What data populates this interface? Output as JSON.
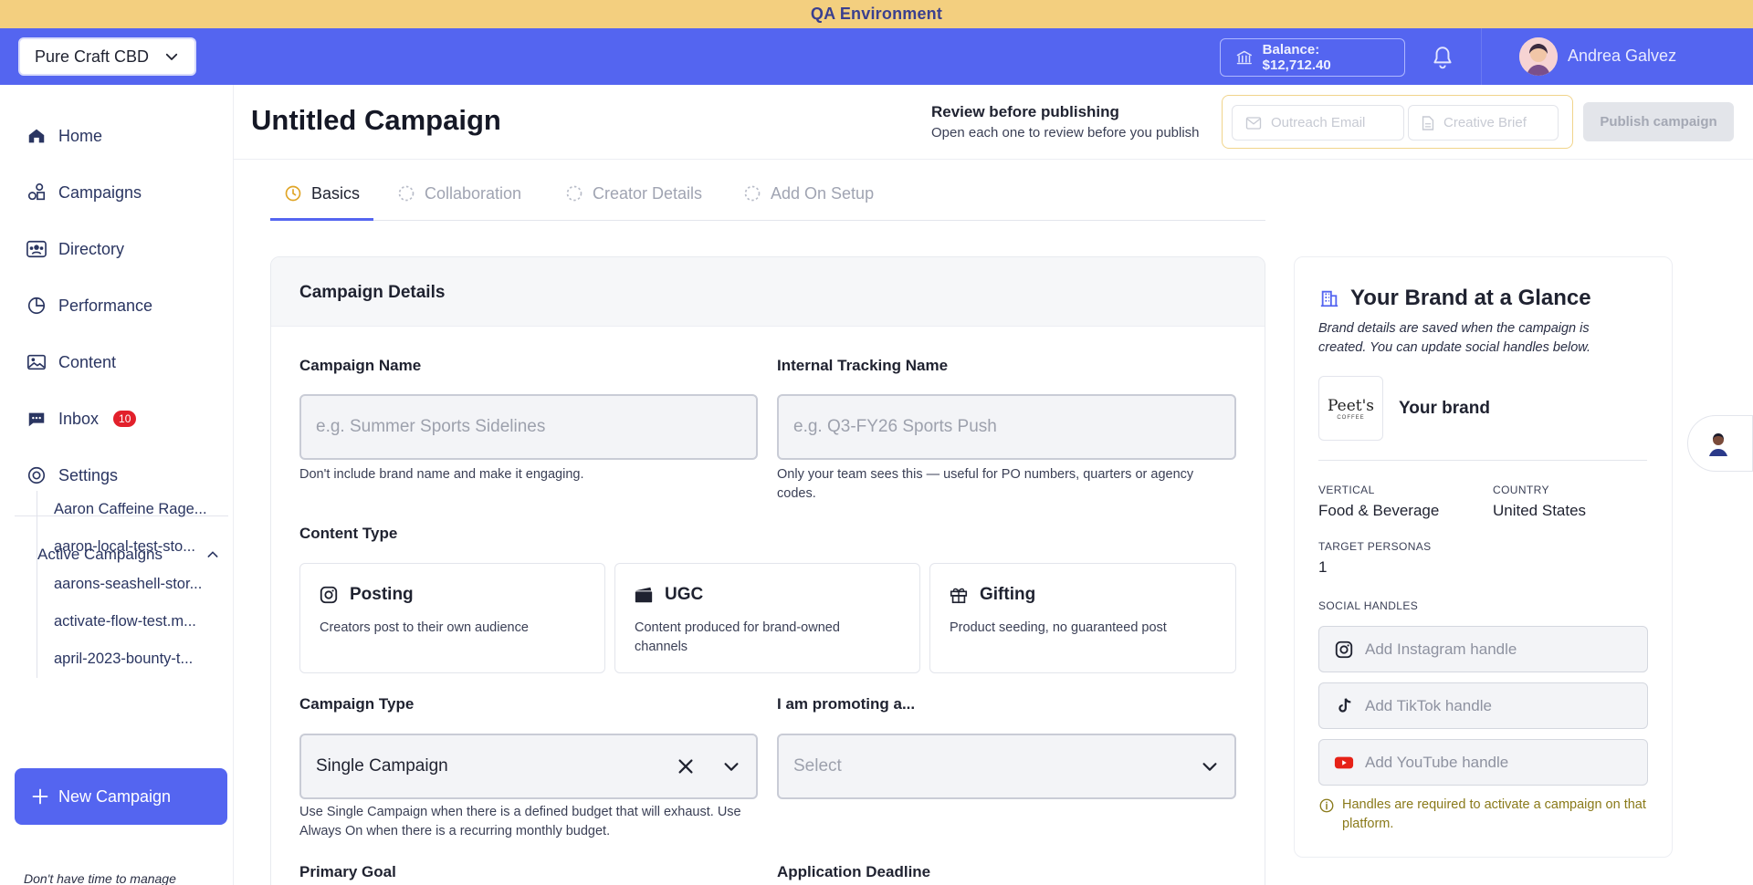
{
  "qa_banner": "QA Environment",
  "topbar": {
    "brand_selector": "Pure Craft CBD",
    "balance": "Balance: $12,712.40",
    "user_name": "Andrea Galvez"
  },
  "sidebar": {
    "items": [
      {
        "label": "Home",
        "icon": "home-icon"
      },
      {
        "label": "Campaigns",
        "icon": "campaigns-icon"
      },
      {
        "label": "Directory",
        "icon": "directory-icon"
      },
      {
        "label": "Performance",
        "icon": "performance-icon"
      },
      {
        "label": "Content",
        "icon": "content-icon"
      },
      {
        "label": "Inbox",
        "icon": "inbox-icon",
        "badge": "10"
      },
      {
        "label": "Settings",
        "icon": "settings-icon"
      }
    ],
    "active_campaigns_label": "Active Campaigns",
    "active_campaigns": [
      "Aaron Caffeine Rage...",
      "aaron-local-test-sto...",
      "aarons-seashell-stor...",
      "activate-flow-test.m...",
      "april-2023-bounty-t..."
    ],
    "new_campaign_label": "New Campaign",
    "footer_text": "Don't have time to manage"
  },
  "header": {
    "title": "Untitled Campaign",
    "review_title": "Review before publishing",
    "review_subtitle": "Open each one to review before you publish",
    "outreach_email": "Outreach Email",
    "creative_brief": "Creative Brief",
    "publish": "Publish campaign"
  },
  "tabs": [
    "Basics",
    "Collaboration",
    "Creator Details",
    "Add On Setup"
  ],
  "form": {
    "section_title": "Campaign Details",
    "campaign_name_label": "Campaign Name",
    "campaign_name_placeholder": "e.g. Summer Sports Sidelines",
    "campaign_name_help": "Don't include brand name and make it engaging.",
    "tracking_label": "Internal Tracking Name",
    "tracking_placeholder": "e.g. Q3-FY26 Sports Push",
    "tracking_help": "Only your team sees this — useful for PO numbers, quarters or agency codes.",
    "content_type_label": "Content Type",
    "content_types": [
      {
        "title": "Posting",
        "desc": "Creators post to their own audience",
        "icon": "instagram-icon"
      },
      {
        "title": "UGC",
        "desc": "Content produced for brand-owned channels",
        "icon": "clapperboard-icon"
      },
      {
        "title": "Gifting",
        "desc": "Product seeding, no guaranteed post",
        "icon": "gift-icon"
      }
    ],
    "campaign_type_label": "Campaign Type",
    "campaign_type_value": "Single Campaign",
    "campaign_type_help": "Use Single Campaign when there is a defined budget that will exhaust. Use Always On when there is a recurring monthly budget.",
    "promoting_label": "I am promoting a...",
    "promoting_placeholder": "Select",
    "primary_goal_label": "Primary Goal",
    "deadline_label": "Application Deadline"
  },
  "brand_panel": {
    "title": "Your Brand at a Glance",
    "subtitle": "Brand details are saved when the campaign is created. You can update social handles below.",
    "logo_text": "Peet's",
    "logo_sub": "COFFEE",
    "brand_name": "Your brand",
    "vertical_label": "VERTICAL",
    "vertical_value": "Food & Beverage",
    "country_label": "COUNTRY",
    "country_value": "United States",
    "personas_label": "TARGET PERSONAS",
    "personas_value": "1",
    "social_label": "SOCIAL HANDLES",
    "instagram_placeholder": "Add Instagram handle",
    "tiktok_placeholder": "Add TikTok handle",
    "youtube_placeholder": "Add YouTube handle",
    "note": "Handles are required to activate a campaign on that platform."
  },
  "colors": {
    "accent": "#5465f0",
    "banner": "#f3cf7f",
    "badge": "#e2202b"
  }
}
